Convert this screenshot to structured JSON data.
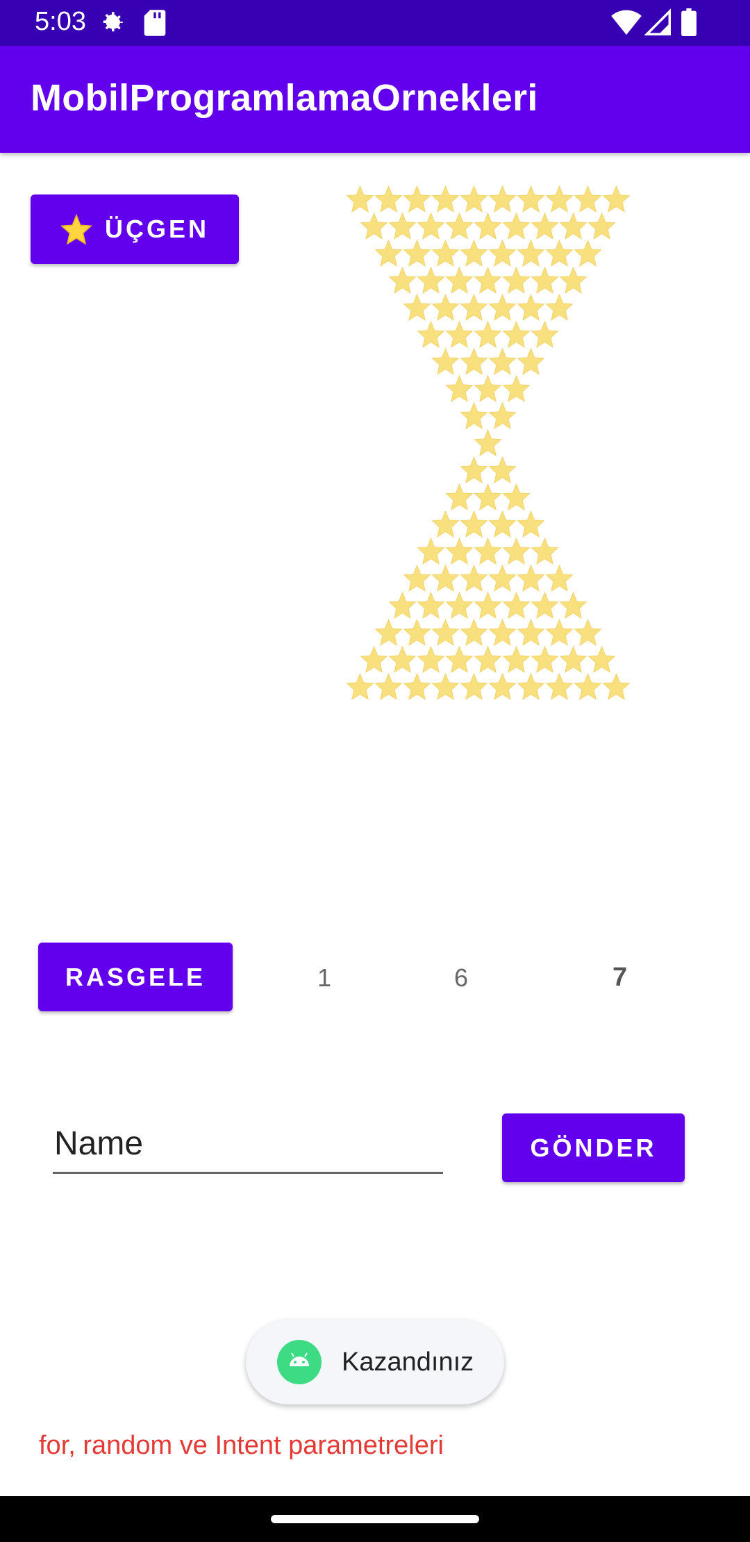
{
  "status_bar": {
    "time": "5:03",
    "icons": [
      "settings-icon",
      "sd-card-icon",
      "wifi-icon",
      "signal-icon",
      "battery-icon"
    ]
  },
  "app_bar": {
    "title": "MobilProgramlamaOrnekleri"
  },
  "triangle_button": {
    "icon": "star-icon",
    "label": "ÜÇGEN"
  },
  "star_pattern": {
    "icon": "star-icon",
    "row_counts": [
      10,
      9,
      8,
      7,
      6,
      5,
      4,
      3,
      2,
      1,
      2,
      3,
      4,
      5,
      6,
      7,
      8,
      9,
      10
    ],
    "color": "#f9e07e"
  },
  "random": {
    "button_label": "RASGELE",
    "numbers": [
      "1",
      "6",
      "7"
    ]
  },
  "form": {
    "name_placeholder": "Name",
    "send_label": "GÖNDER"
  },
  "toast": {
    "icon": "android-icon",
    "text": "Kazandınız"
  },
  "footer": {
    "text": "for, random ve Intent parametreleri"
  },
  "colors": {
    "primary": "#6200ee",
    "primary_dark": "#3700b3",
    "footer_text": "#e53935"
  }
}
